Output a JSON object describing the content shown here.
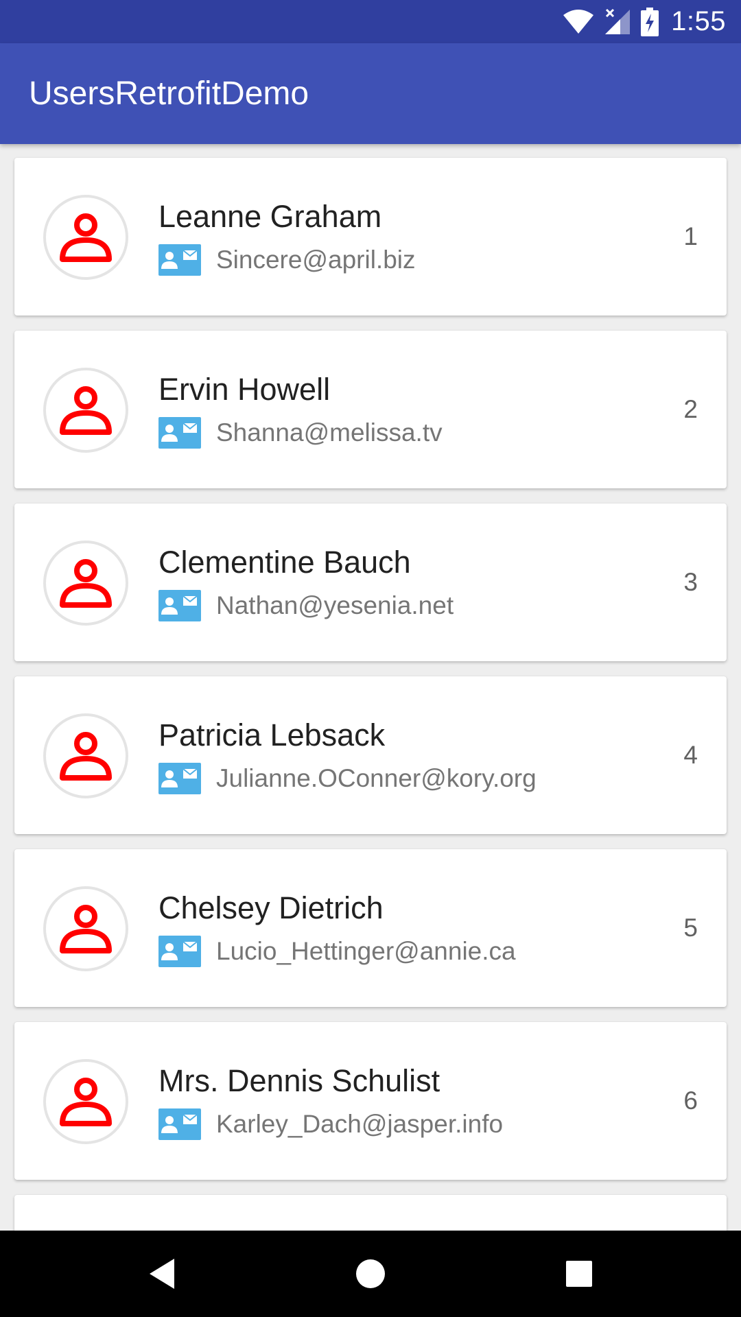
{
  "status_bar": {
    "time": "1:55",
    "icons": [
      "wifi-icon",
      "cell-signal-icon",
      "battery-charging-icon"
    ]
  },
  "app_bar": {
    "title": "UsersRetrofitDemo"
  },
  "colors": {
    "status_bar": "#303f9f",
    "primary": "#3f51b5",
    "avatar_icon": "#ff0000",
    "email_icon": "#4fb0e6"
  },
  "users": [
    {
      "name": "Leanne Graham",
      "email": "Sincere@april.biz",
      "id": "1"
    },
    {
      "name": "Ervin Howell",
      "email": "Shanna@melissa.tv",
      "id": "2"
    },
    {
      "name": "Clementine Bauch",
      "email": "Nathan@yesenia.net",
      "id": "3"
    },
    {
      "name": "Patricia Lebsack",
      "email": "Julianne.OConner@kory.org",
      "id": "4"
    },
    {
      "name": "Chelsey Dietrich",
      "email": "Lucio_Hettinger@annie.ca",
      "id": "5"
    },
    {
      "name": "Mrs. Dennis Schulist",
      "email": "Karley_Dach@jasper.info",
      "id": "6"
    }
  ],
  "nav_bar": {
    "buttons": [
      "back-icon",
      "home-icon",
      "recents-icon"
    ]
  }
}
